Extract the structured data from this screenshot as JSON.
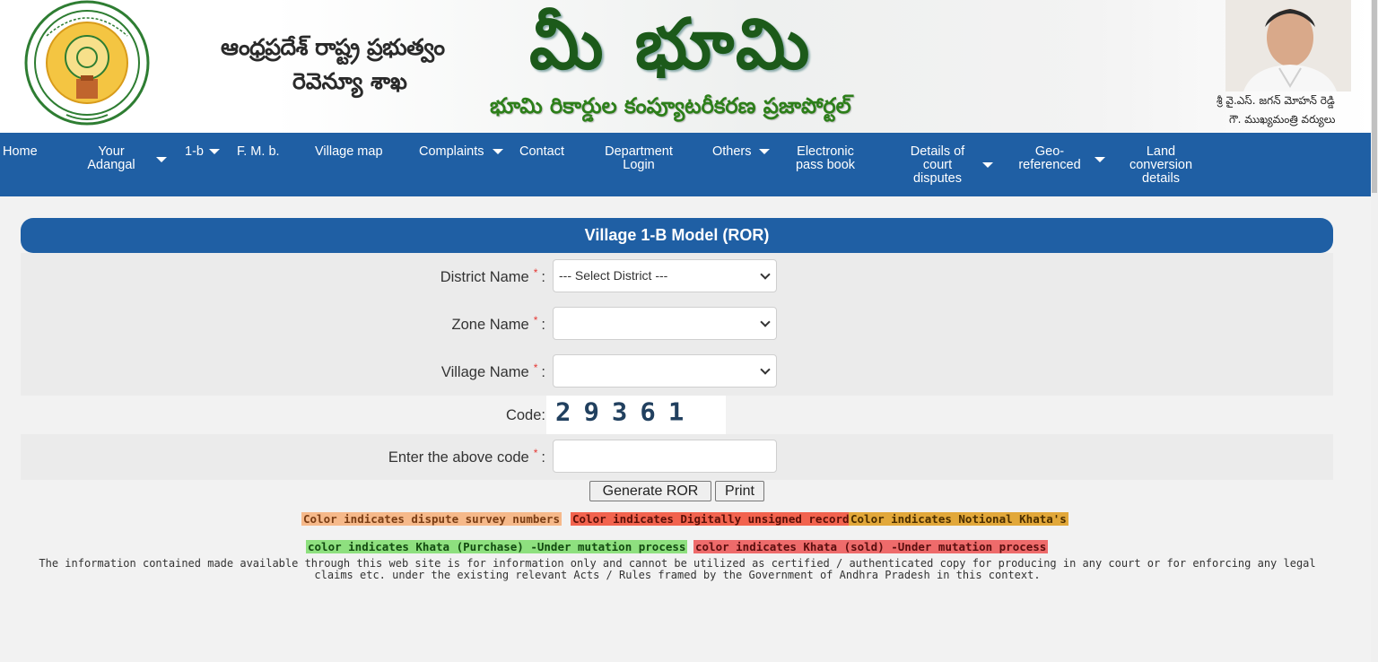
{
  "header": {
    "telugu_line1": "ఆంధ్రప్రదేశ్ రాష్ట్ర ప్రభుత్వం",
    "telugu_line2": "రెవెన్యూ శాఖ",
    "big_title": "మీ భూమి",
    "sub_title": "భూమి రికార్డుల కంప్యూటరీకరణ ప్రజాపోర్టల్",
    "cm_line1": "శ్రీ వై.ఎస్. జగన్ మోహన్ రెడ్డి",
    "cm_line2": "గౌ. ముఖ్యమంత్రి వర్యులు"
  },
  "nav": {
    "items": [
      {
        "label": "Home",
        "icon": "none"
      },
      {
        "label": "Your\nAdangal",
        "icon": "caret-down-icon"
      },
      {
        "label": "1-b",
        "icon": "caret-down-icon"
      },
      {
        "label": "F. M. b.",
        "icon": "none"
      },
      {
        "label": "Village map",
        "icon": "none"
      },
      {
        "label": "Complaints",
        "icon": "caret-down-icon"
      },
      {
        "label": "Contact",
        "icon": "none"
      },
      {
        "label": "Department\nLogin",
        "icon": "none"
      },
      {
        "label": "Others",
        "icon": "caret-down-icon"
      },
      {
        "label": "Electronic\npass book",
        "icon": "none"
      },
      {
        "label": "Details of\ncourt\ndisputes",
        "icon": "caret-down-icon"
      },
      {
        "label": "Geo-\nreferenced",
        "icon": "caret-down-icon"
      },
      {
        "label": "Land\nconversion\ndetails",
        "icon": "none"
      }
    ]
  },
  "form": {
    "title": "Village 1-B Model (ROR)",
    "district_label": "District Name",
    "district_value": "--- Select District ---",
    "zone_label": "Zone Name",
    "zone_value": "",
    "village_label": "Village Name",
    "village_value": "",
    "code_label": "Code:",
    "captcha": "29361",
    "enter_code_label": "Enter the above code",
    "enter_code_value": "",
    "required_mark": "*",
    "colon": ":",
    "generate_button": "Generate ROR",
    "print_button": "Print"
  },
  "legend": [
    {
      "text": "Color indicates dispute survey numbers",
      "color": "#f6b98a"
    },
    {
      "text": "Color indicates Digitally unsigned records",
      "color": "#f2634e"
    },
    {
      "text": "Color indicates Notional Khata's",
      "color": "#e2a83a"
    },
    {
      "text": "color indicates Khata (Purchase) -Under mutation process",
      "color": "#8ee07f"
    },
    {
      "text": "color indicates Khata (sold) -Under mutation process",
      "color": "#ee6b6b"
    }
  ],
  "disclaimer": "The information contained made available through this web site is for information only and cannot be utilized as certified / authenticated copy for producing in any court or for enforcing any legal claims etc. under the existing relevant Acts / Rules framed by the Government of Andhra Pradesh in this context."
}
